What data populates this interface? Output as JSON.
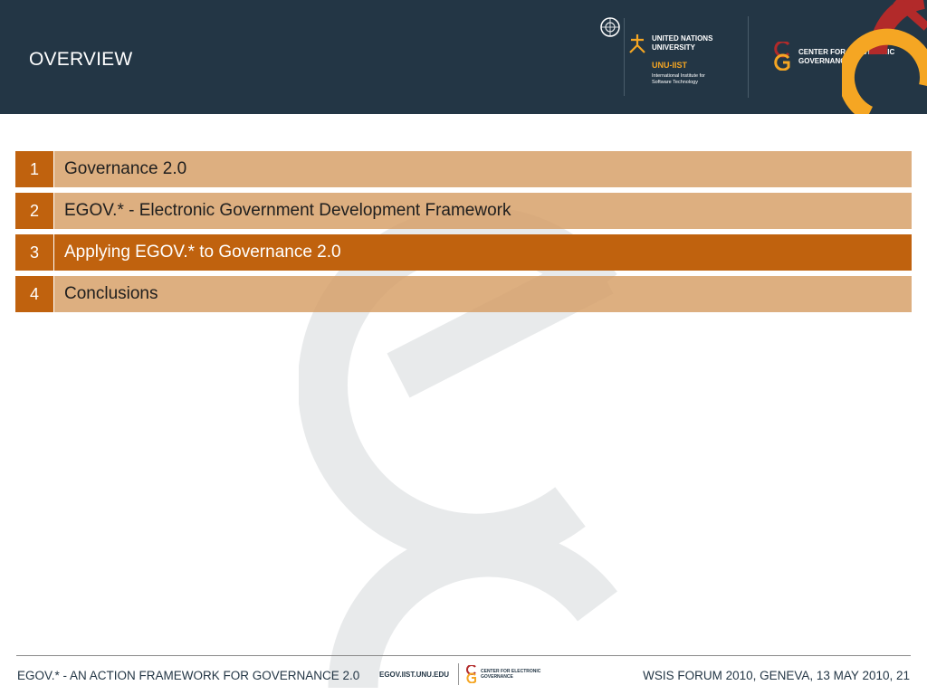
{
  "header": {
    "title": "OVERVIEW",
    "unu": {
      "name": "UNITED NATIONS UNIVERSITY",
      "institute": "UNU-IIST",
      "institute_full": "International Institute for Software Technology"
    },
    "ceg": {
      "name": "CENTER FOR ELECTRONIC GOVERNANCE"
    }
  },
  "agenda": [
    {
      "number": "1",
      "label": "Governance 2.0"
    },
    {
      "number": "2",
      "label": "EGOV.* - Electronic Government Development Framework"
    },
    {
      "number": "3",
      "label": "Applying EGOV.* to Governance 2.0"
    },
    {
      "number": "4",
      "label": "Conclusions"
    }
  ],
  "footer": {
    "left": "EGOV.* - AN ACTION FRAMEWORK FOR GOVERNANCE 2.0",
    "url": "EGOV.IIST.UNU.EDU",
    "ceg": "CENTER FOR ELECTRONIC GOVERNANCE",
    "right": "WSIS FORUM 2010, GENEVA, 13 MAY 2010, 21"
  },
  "colors": {
    "header_bg": "#233645",
    "accent": "#c0620e",
    "row_bg": "#d69e64",
    "logo_orange": "#f5a623",
    "logo_red": "#b22a2a"
  }
}
